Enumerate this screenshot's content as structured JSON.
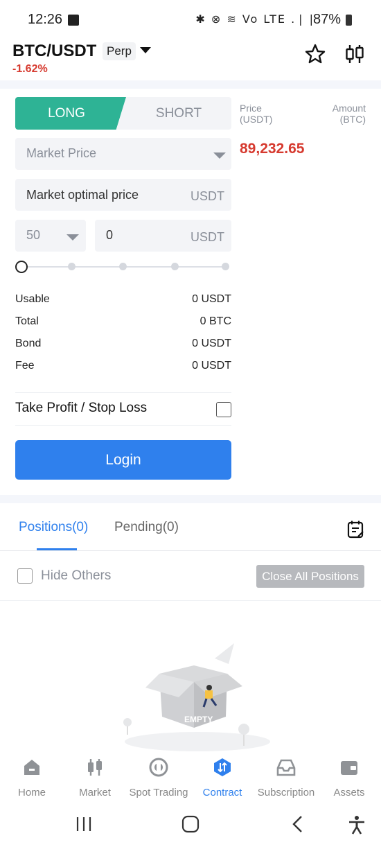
{
  "status_bar": {
    "time": "12:26",
    "icons_text": "✱ ⊗ ≋ Vo LTE .❘❘",
    "battery": "87%"
  },
  "header": {
    "pair": "BTC/USDT",
    "type_badge": "Perp",
    "change": "-1.62%",
    "favorite_icon": "star-icon",
    "chart_icon": "candlestick-icon"
  },
  "trade": {
    "long_label": "LONG",
    "short_label": "SHORT",
    "order_type": "Market Price",
    "price_field_text": "Market optimal price",
    "price_unit": "USDT",
    "leverage": "50",
    "amount_value": "0",
    "amount_unit": "USDT",
    "slider_percent": 0,
    "info": [
      {
        "key": "Usable",
        "value": "0 USDT"
      },
      {
        "key": "Total",
        "value": "0 BTC"
      },
      {
        "key": "Bond",
        "value": "0 USDT"
      },
      {
        "key": "Fee",
        "value": "0 USDT"
      }
    ],
    "tpsl_label": "Take Profit / Stop Loss",
    "login_label": "Login"
  },
  "orderbook": {
    "price_label_1": "Price",
    "price_label_2": "(USDT)",
    "amount_label_1": "Amount",
    "amount_label_2": "(BTC)",
    "last_price": "89,232.65"
  },
  "positions": {
    "tab_positions": "Positions(0)",
    "tab_pending": "Pending(0)",
    "hide_others": "Hide Others",
    "close_all": "Close All Positions",
    "empty_label": "EMPTY"
  },
  "bottom_nav": [
    {
      "label": "Home",
      "icon": "home-icon"
    },
    {
      "label": "Market",
      "icon": "market-icon"
    },
    {
      "label": "Spot Trading",
      "icon": "spot-icon"
    },
    {
      "label": "Contract",
      "icon": "contract-icon",
      "active": true
    },
    {
      "label": "Subscription",
      "icon": "subscription-icon"
    },
    {
      "label": "Assets",
      "icon": "wallet-icon"
    }
  ],
  "colors": {
    "long_green": "#2eb395",
    "accent_blue": "#2f80ed",
    "down_red": "#d63a2f"
  }
}
